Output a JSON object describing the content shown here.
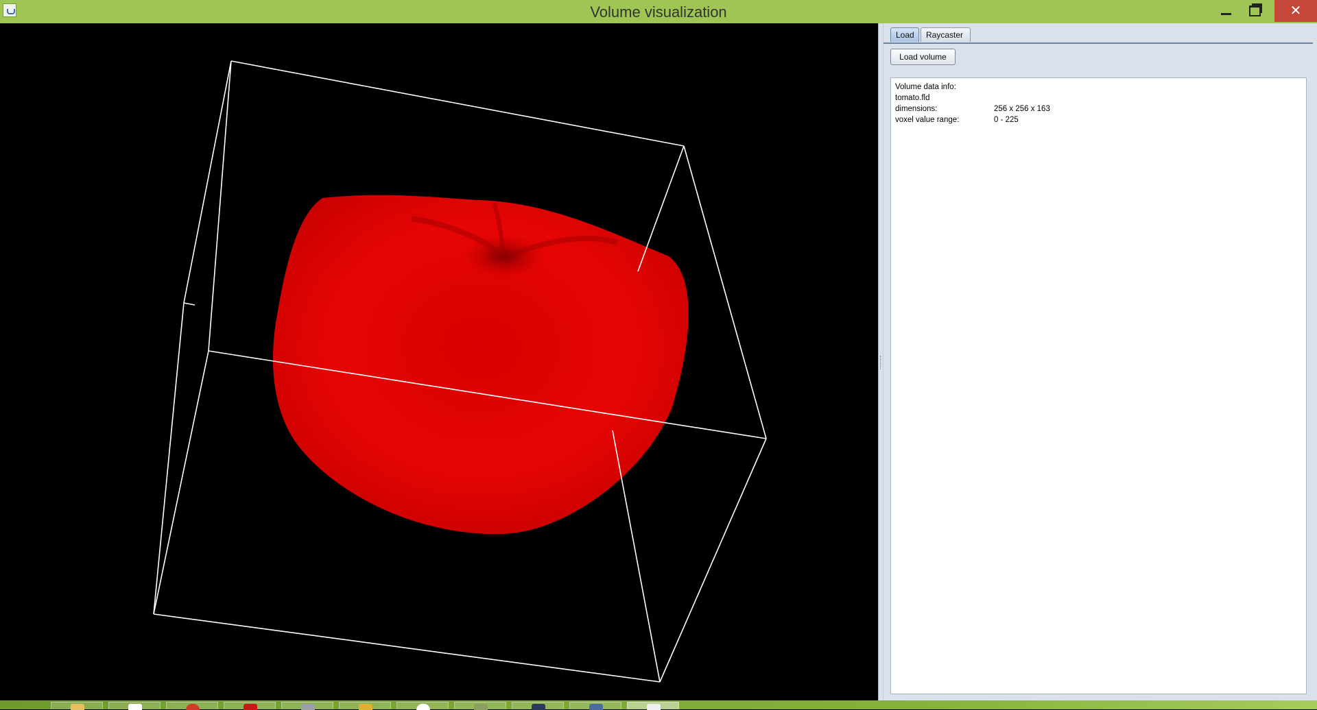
{
  "window": {
    "title": "Volume visualization",
    "app_icon": "java-cup-icon",
    "controls": [
      "minimize-icon",
      "maximize-icon",
      "close-icon"
    ],
    "close_color": "#c7463a",
    "titlebar_color": "#9fc654"
  },
  "viewport": {
    "background": "#000000",
    "object": "tomato-volume-render",
    "object_color": "#e00000",
    "bounding_box_color": "#ffffff"
  },
  "tabs": [
    {
      "label": "Load",
      "active": true
    },
    {
      "label": "Raycaster",
      "active": false
    }
  ],
  "load_panel": {
    "load_button_label": "Load volume",
    "info": {
      "heading": "Volume data info:",
      "filename": "tomato.fld",
      "rows": [
        {
          "key": "dimensions:",
          "value": "256 x 256 x 163"
        },
        {
          "key": "voxel value range:",
          "value": "0 - 225"
        }
      ]
    }
  },
  "taskbar": {
    "items": [
      "file-explorer-icon",
      "document-icon",
      "red-app-icon",
      "red-app-icon-2",
      "app-icon-5",
      "app-icon-6",
      "app-icon-7",
      "app-icon-8",
      "shield-icon",
      "window-app-icon",
      "java-app-icon"
    ]
  }
}
